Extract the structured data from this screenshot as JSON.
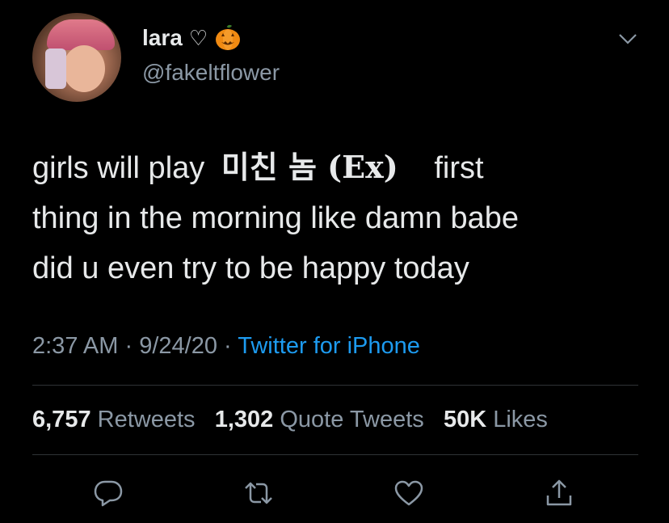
{
  "tweet": {
    "display_name": "lara",
    "name_symbols": "♡",
    "handle": "@fakeltflower",
    "text": {
      "part1": "girls will play",
      "korean_title": "미친 놈 (Ex)",
      "part2": "first",
      "line2": "thing in the morning like damn babe",
      "line3": "did u even try to be happy today"
    },
    "time": "2:37 AM",
    "dot1": "·",
    "date": "9/24/20",
    "dot2": "·",
    "source": "Twitter for iPhone"
  },
  "stats": {
    "retweets_count": "6,757",
    "retweets_label": "Retweets",
    "quotes_count": "1,302",
    "quotes_label": "Quote Tweets",
    "likes_count": "50K",
    "likes_label": "Likes"
  },
  "icons": {
    "reply": "reply-icon",
    "retweet": "retweet-icon",
    "like": "like-icon",
    "share": "share-icon",
    "more": "chevron-down-icon",
    "pumpkin": "jack-o-lantern-icon"
  },
  "colors": {
    "background": "#000000",
    "text": "#e7e9ea",
    "secondary": "#8b98a5",
    "link": "#1d9bf0",
    "divider": "#2f3336"
  }
}
